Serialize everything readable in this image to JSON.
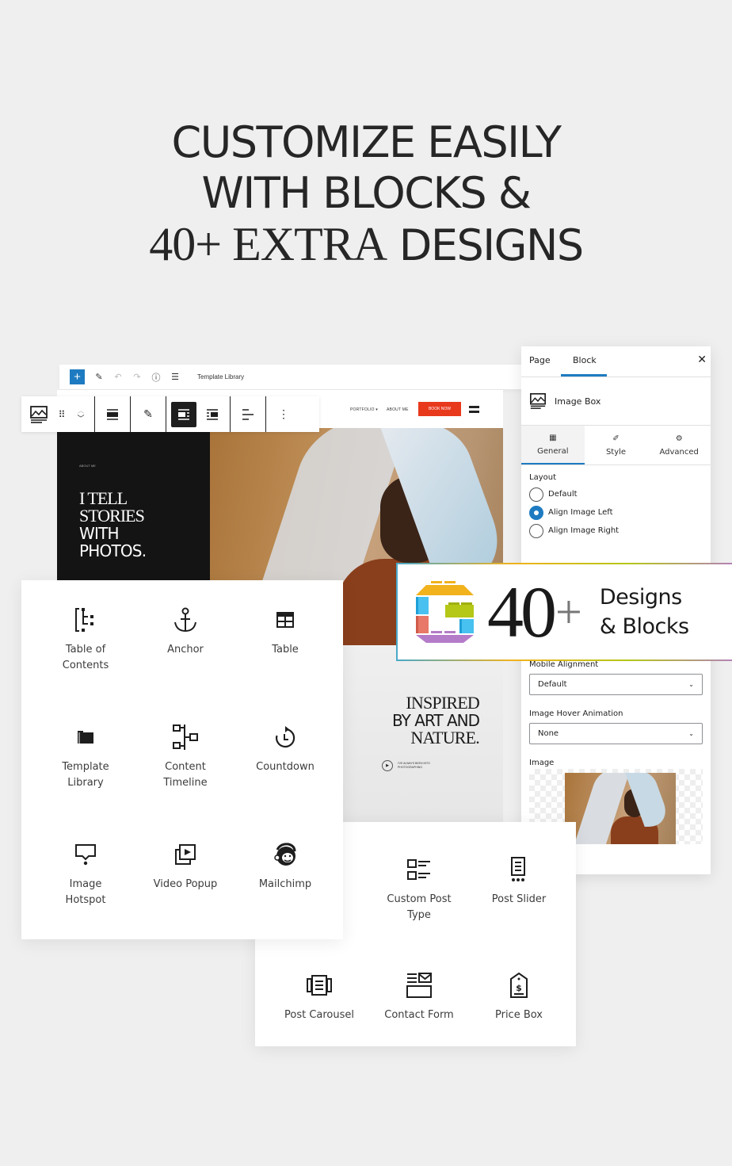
{
  "headline": {
    "line1": "CUSTOMIZE EASILY",
    "line2": "WITH BLOCKS &",
    "line3_serif": "40+ EXTRA",
    "line3_bold": "DESIGNS"
  },
  "editor": {
    "title": "Template Library",
    "icons": [
      "plus-icon",
      "pencil-icon",
      "undo-icon",
      "redo-icon",
      "info-icon",
      "list-view-icon"
    ]
  },
  "site": {
    "nav": {
      "portfolio": "PORTFOLIO ▾",
      "about": "ABOUT ME",
      "book": "BOOK NOW"
    },
    "hero_small": "ABOUT ME",
    "hero_serif1": "I TELL",
    "hero_serif2": "STORIES",
    "hero_bold1": "WITH",
    "hero_bold2": "PHOTOS.",
    "inspired_serif": "INSPIRED",
    "inspired_bold": "BY ART AND",
    "inspired_serif2": "NATURE.",
    "play_text": "I'VE ALWAYS BEEN INTO PHOTOGRAPHING",
    "accent": "#e8391c"
  },
  "block_toolbar": {
    "buttons": [
      "image-box-icon",
      "drag-handle-icon",
      "move-up-down-icon",
      "align-wide-icon",
      "pencil-icon",
      "align-image-left-icon",
      "align-image-right-icon",
      "text-align-icon",
      "more-options-icon"
    ],
    "active": "align-image-left-icon"
  },
  "inspector": {
    "tabs": {
      "page": "Page",
      "block": "Block"
    },
    "close": "✕",
    "block_name": "Image Box",
    "subtabs": {
      "general": "General",
      "style": "Style",
      "advanced": "Advanced"
    },
    "layout": {
      "label": "Layout",
      "options": [
        "Default",
        "Align Image Left",
        "Align Image Right"
      ],
      "selected": "Align Image Left"
    },
    "mobile_alignment": {
      "label": "Mobile Alignment",
      "value": "Default"
    },
    "hover_animation": {
      "label": "Image Hover Animation",
      "value": "None"
    },
    "image_label": "Image",
    "accent": "#1e7bc1"
  },
  "banner": {
    "number": "40",
    "plus": "+",
    "line1": "Designs",
    "line2": "& Blocks"
  },
  "blocks_left": [
    {
      "label1": "Table of",
      "label2": "Contents",
      "icon": "table-of-contents-icon"
    },
    {
      "label1": "Anchor",
      "label2": "",
      "icon": "anchor-icon"
    },
    {
      "label1": "Table",
      "label2": "",
      "icon": "table-icon"
    },
    {
      "label1": "Template",
      "label2": "Library",
      "icon": "folder-icon"
    },
    {
      "label1": "Content",
      "label2": "Timeline",
      "icon": "timeline-icon"
    },
    {
      "label1": "Countdown",
      "label2": "",
      "icon": "countdown-icon"
    },
    {
      "label1": "Image",
      "label2": "Hotspot",
      "icon": "hotspot-icon"
    },
    {
      "label1": "Video Popup",
      "label2": "",
      "icon": "video-popup-icon"
    },
    {
      "label1": "Mailchimp",
      "label2": "",
      "icon": "mailchimp-icon"
    }
  ],
  "blocks_bottom": [
    {
      "label1": "Custom Post",
      "label2": "Type",
      "icon": "custom-post-type-icon"
    },
    {
      "label1": "Post Slider",
      "label2": "",
      "icon": "post-slider-icon"
    },
    {
      "label1": "Post Carousel",
      "label2": "",
      "icon": "post-carousel-icon"
    },
    {
      "label1": "Contact Form",
      "label2": "",
      "icon": "contact-form-icon"
    },
    {
      "label1": "Price Box",
      "label2": "",
      "icon": "price-box-icon"
    }
  ]
}
